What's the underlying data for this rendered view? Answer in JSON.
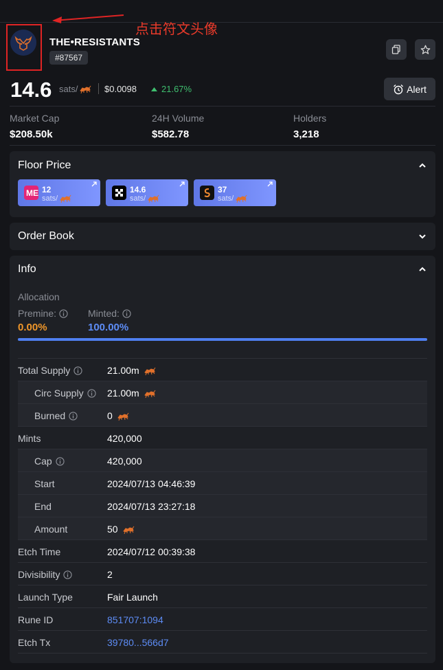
{
  "annotation": {
    "text": "点击符文头像"
  },
  "header": {
    "name": "THE•RESISTANTS",
    "number": "#87567"
  },
  "price": {
    "value": "14.6",
    "unit": "sats/",
    "usd": "$0.0098",
    "change": "21.67%"
  },
  "alert_label": "Alert",
  "stats": [
    {
      "label": "Market Cap",
      "value": "$208.50k"
    },
    {
      "label": "24H Volume",
      "value": "$582.78"
    },
    {
      "label": "Holders",
      "value": "3,218"
    }
  ],
  "floor_price": {
    "title": "Floor Price",
    "markets": [
      {
        "icon": "magic-eden-logo",
        "value": "12",
        "unit": "sats/"
      },
      {
        "icon": "okx-logo",
        "value": "14.6",
        "unit": "sats/"
      },
      {
        "icon": "satflow-logo",
        "value": "37",
        "unit": "sats/"
      }
    ]
  },
  "order_book": {
    "title": "Order Book"
  },
  "info": {
    "title": "Info",
    "allocation_label": "Allocation",
    "premine_label": "Premine:",
    "premine_value": "0.00%",
    "minted_label": "Minted:",
    "minted_value": "100.00%",
    "minted_fraction": 1.0,
    "rows": [
      {
        "label": "Total Supply",
        "value": "21.00m"
      },
      {
        "label": "Circ Supply",
        "value": "21.00m"
      },
      {
        "label": "Burned",
        "value": "0"
      },
      {
        "label": "Mints",
        "value": "420,000"
      },
      {
        "label": "Cap",
        "value": "420,000"
      },
      {
        "label": "Start",
        "value": "2024/07/13 04:46:39"
      },
      {
        "label": "End",
        "value": "2024/07/13 23:27:18"
      },
      {
        "label": "Amount",
        "value": "50"
      },
      {
        "label": "Etch Time",
        "value": "2024/07/12 00:39:38"
      },
      {
        "label": "Divisibility",
        "value": "2"
      },
      {
        "label": "Launch Type",
        "value": "Fair Launch"
      },
      {
        "label": "Rune ID",
        "value": "851707:1094"
      },
      {
        "label": "Etch Tx",
        "value": "39780...566d7"
      }
    ]
  },
  "colors": {
    "accent": "#5d8cf5",
    "positive": "#3fbf6f",
    "premine": "#f0972a",
    "annotation": "#e02424"
  }
}
